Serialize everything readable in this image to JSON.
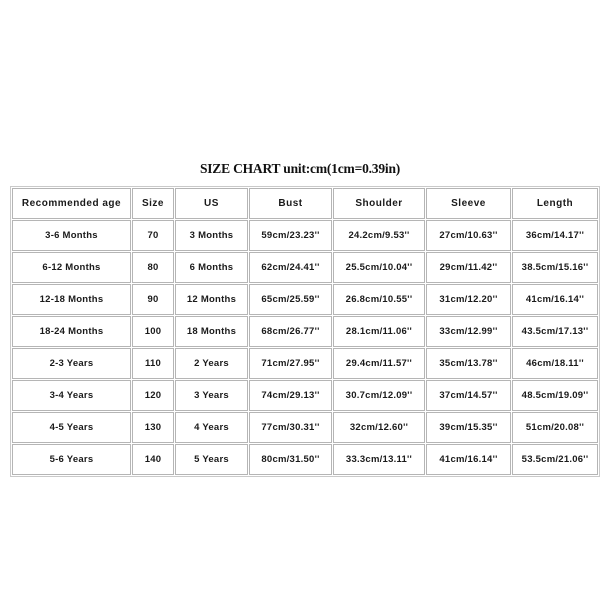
{
  "title": "SIZE CHART unit:cm(1cm=0.39in)",
  "chart_data": {
    "type": "table",
    "title": "SIZE CHART unit:cm(1cm=0.39in)",
    "xlabel": "",
    "ylabel": "",
    "grid": true,
    "legend": "none",
    "columns": [
      "Recommended age",
      "Size",
      "US",
      "Bust",
      "Shoulder",
      "Sleeve",
      "Length"
    ],
    "rows": [
      [
        "3-6 Months",
        "70",
        "3 Months",
        "59cm/23.23''",
        "24.2cm/9.53''",
        "27cm/10.63''",
        "36cm/14.17''"
      ],
      [
        "6-12 Months",
        "80",
        "6 Months",
        "62cm/24.41''",
        "25.5cm/10.04''",
        "29cm/11.42''",
        "38.5cm/15.16''"
      ],
      [
        "12-18 Months",
        "90",
        "12 Months",
        "65cm/25.59''",
        "26.8cm/10.55''",
        "31cm/12.20''",
        "41cm/16.14''"
      ],
      [
        "18-24 Months",
        "100",
        "18 Months",
        "68cm/26.77''",
        "28.1cm/11.06''",
        "33cm/12.99''",
        "43.5cm/17.13''"
      ],
      [
        "2-3 Years",
        "110",
        "2 Years",
        "71cm/27.95''",
        "29.4cm/11.57''",
        "35cm/13.78''",
        "46cm/18.11''"
      ],
      [
        "3-4 Years",
        "120",
        "3 Years",
        "74cm/29.13''",
        "30.7cm/12.09''",
        "37cm/14.57''",
        "48.5cm/19.09''"
      ],
      [
        "4-5 Years",
        "130",
        "4 Years",
        "77cm/30.31''",
        "32cm/12.60''",
        "39cm/15.35''",
        "51cm/20.08''"
      ],
      [
        "5-6 Years",
        "140",
        "5 Years",
        "80cm/31.50''",
        "33.3cm/13.11''",
        "41cm/16.14''",
        "53.5cm/21.06''"
      ]
    ],
    "series": [
      {
        "name": "Size",
        "values": [
          70,
          80,
          90,
          100,
          110,
          120,
          130,
          140
        ]
      },
      {
        "name": "Bust (cm)",
        "values": [
          59,
          62,
          65,
          68,
          71,
          74,
          77,
          80
        ]
      },
      {
        "name": "Bust (in)",
        "values": [
          23.23,
          24.41,
          25.59,
          26.77,
          27.95,
          29.13,
          30.31,
          31.5
        ]
      },
      {
        "name": "Shoulder (cm)",
        "values": [
          24.2,
          25.5,
          26.8,
          28.1,
          29.4,
          30.7,
          32,
          33.3
        ]
      },
      {
        "name": "Shoulder (in)",
        "values": [
          9.53,
          10.04,
          10.55,
          11.06,
          11.57,
          12.09,
          12.6,
          13.11
        ]
      },
      {
        "name": "Sleeve (cm)",
        "values": [
          27,
          29,
          31,
          33,
          35,
          37,
          39,
          41
        ]
      },
      {
        "name": "Sleeve (in)",
        "values": [
          10.63,
          11.42,
          12.2,
          12.99,
          13.78,
          14.57,
          15.35,
          16.14
        ]
      },
      {
        "name": "Length (cm)",
        "values": [
          36,
          38.5,
          41,
          43.5,
          46,
          48.5,
          51,
          53.5
        ]
      },
      {
        "name": "Length (in)",
        "values": [
          14.17,
          15.16,
          16.14,
          17.13,
          18.11,
          19.09,
          20.08,
          21.06
        ]
      }
    ],
    "categories": [
      "3-6 Months",
      "6-12 Months",
      "12-18 Months",
      "18-24 Months",
      "2-3 Years",
      "3-4 Years",
      "4-5 Years",
      "5-6 Years"
    ]
  },
  "colors": {
    "background": "#ffffff",
    "text": "#1a1a1a",
    "border": "#b5b5b5",
    "outer_border": "#c9c9c9"
  }
}
